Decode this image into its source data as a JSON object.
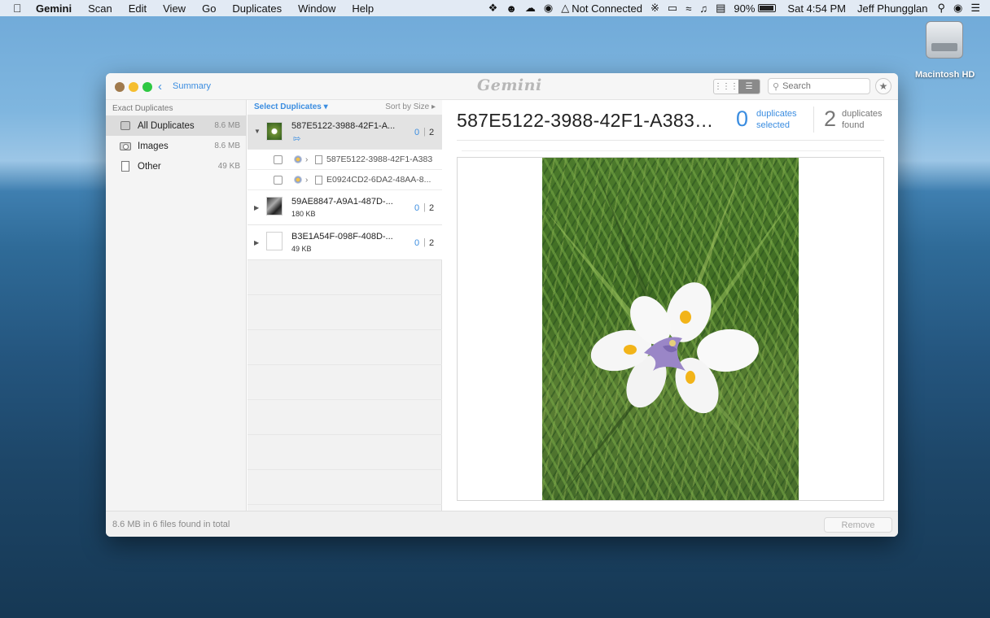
{
  "menubar": {
    "app_name": "Gemini",
    "items": [
      "Scan",
      "Edit",
      "View",
      "Go",
      "Duplicates",
      "Window",
      "Help"
    ],
    "status": {
      "network": "Not Connected",
      "battery": "90%",
      "clock": "Sat 4:54 PM",
      "user": "Jeff Phungglan"
    }
  },
  "desktop": {
    "drive_label": "Macintosh HD"
  },
  "window": {
    "back_label": "Summary",
    "logo_text": "Gemini",
    "search_placeholder": "Search"
  },
  "sidebar": {
    "header": "Exact Duplicates",
    "items": [
      {
        "label": "All Duplicates",
        "size": "8.6 MB",
        "icon": "drive-icon",
        "selected": true
      },
      {
        "label": "Images",
        "size": "8.6 MB",
        "icon": "camera-icon",
        "selected": false
      },
      {
        "label": "Other",
        "size": "49 KB",
        "icon": "document-icon",
        "selected": false
      }
    ]
  },
  "list": {
    "select_label": "Select Duplicates",
    "sort_label": "Sort by Size",
    "groups": [
      {
        "name": "587E5122-3988-42F1-A...",
        "selected_count": "0",
        "found_count": "2",
        "expanded": true,
        "children": [
          {
            "name": "587E5122-3988-42F1-A383-..."
          },
          {
            "name": "E0924CD2-6DA2-48AA-8..."
          }
        ]
      },
      {
        "name": "59AE8847-A9A1-487D-...",
        "size": "180 KB",
        "selected_count": "0",
        "found_count": "2"
      },
      {
        "name": "B3E1A54F-098F-408D-...",
        "size": "49 KB",
        "selected_count": "0",
        "found_count": "2"
      }
    ]
  },
  "detail": {
    "title": "587E5122-3988-42F1-A383-...",
    "selected_count": "0",
    "selected_label_1": "duplicates",
    "selected_label_2": "selected",
    "found_count": "2",
    "found_label_1": "duplicates",
    "found_label_2": "found"
  },
  "footer": {
    "status": "8.6 MB in 6 files found in total",
    "remove_label": "Remove"
  },
  "colors": {
    "accent": "#3b8de0",
    "close": "#a07a4d",
    "minimize": "#f5be2f",
    "maximize": "#2ec842"
  }
}
